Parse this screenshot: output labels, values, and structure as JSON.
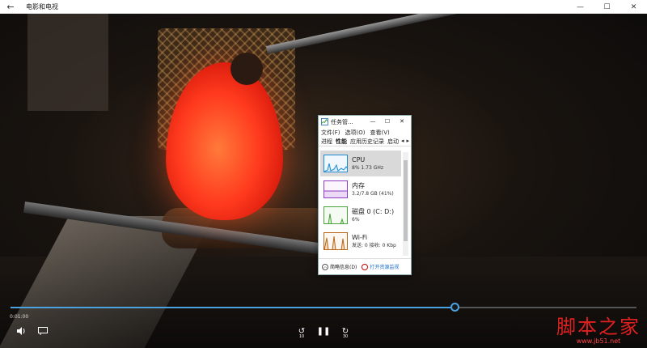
{
  "window": {
    "title": "电影和电视",
    "back_icon": "back-arrow-icon",
    "minimize_glyph": "—",
    "maximize_glyph": "☐",
    "close_glyph": "✕"
  },
  "player": {
    "current_time": "0:01:00",
    "progress": 0.71,
    "rewind_label": "10",
    "forward_label": "30",
    "accent": "#4aa2e0"
  },
  "task_manager": {
    "title": "任务管...",
    "menu": [
      "文件(F)",
      "选项(O)",
      "查看(V)"
    ],
    "tabs": [
      "进程",
      "性能",
      "应用历史记录",
      "启动"
    ],
    "active_tab": "性能",
    "items": [
      {
        "name": "CPU",
        "detail": "8%  1.73 GHz",
        "color": "#1f8ad1"
      },
      {
        "name": "内存",
        "detail": "3.2/7.8 GB (41%)",
        "color": "#8b3ec1"
      },
      {
        "name": "磁盘 0 (C: D:)",
        "detail": "6%",
        "color": "#4aa33c"
      },
      {
        "name": "Wi-Fi",
        "detail": "发送: 0  接收: 0 Kbp",
        "color": "#b8651a"
      }
    ],
    "fewer_details": "简略信息(D)",
    "open_monitor": "打开资源监视"
  },
  "watermark": {
    "main": "脚本之家",
    "url": "www.jb51.net"
  }
}
